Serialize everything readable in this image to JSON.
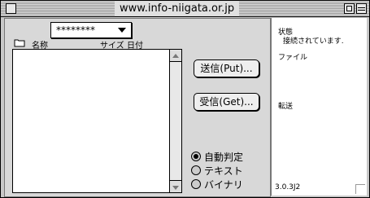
{
  "window": {
    "title": "www.info-niigata.or.jp"
  },
  "toolbar": {
    "popup_value": "********"
  },
  "file_list": {
    "col_name": "名称",
    "col_size": "サイズ",
    "col_date": "日付"
  },
  "actions": {
    "put_label": "送信(Put)...",
    "get_label": "受信(Get)..."
  },
  "modes": {
    "auto": "自動判定",
    "text": "テキスト",
    "binary": "バイナリ",
    "selected": "auto"
  },
  "status": {
    "state_label": "状態",
    "state_value": "接続されています.",
    "file_label": "ファイル",
    "transfer_label": "転送",
    "version": "3.0.3J2"
  }
}
